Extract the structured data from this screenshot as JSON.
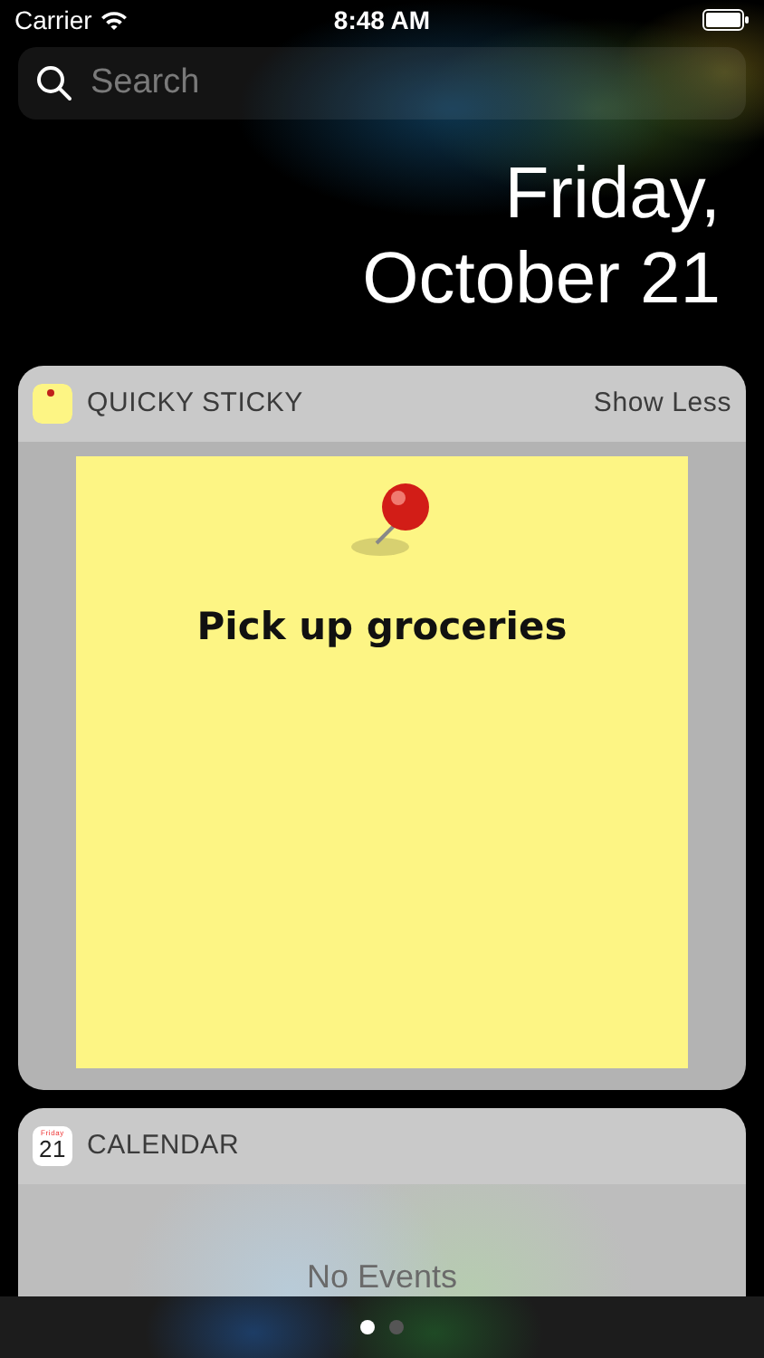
{
  "status_bar": {
    "carrier": "Carrier",
    "time": "8:48 AM"
  },
  "search": {
    "placeholder": "Search"
  },
  "date": {
    "weekday": "Friday,",
    "day": "October 21"
  },
  "widgets": [
    {
      "kind": "sticky",
      "title": "QUICKY STICKY",
      "action": "Show Less",
      "note": "Pick up groceries"
    },
    {
      "kind": "calendar",
      "title": "CALENDAR",
      "icon_weekday": "Friday",
      "icon_day": "21",
      "message": "No Events"
    }
  ],
  "page_dots": [
    {
      "selected": true
    },
    {
      "selected": false
    }
  ]
}
